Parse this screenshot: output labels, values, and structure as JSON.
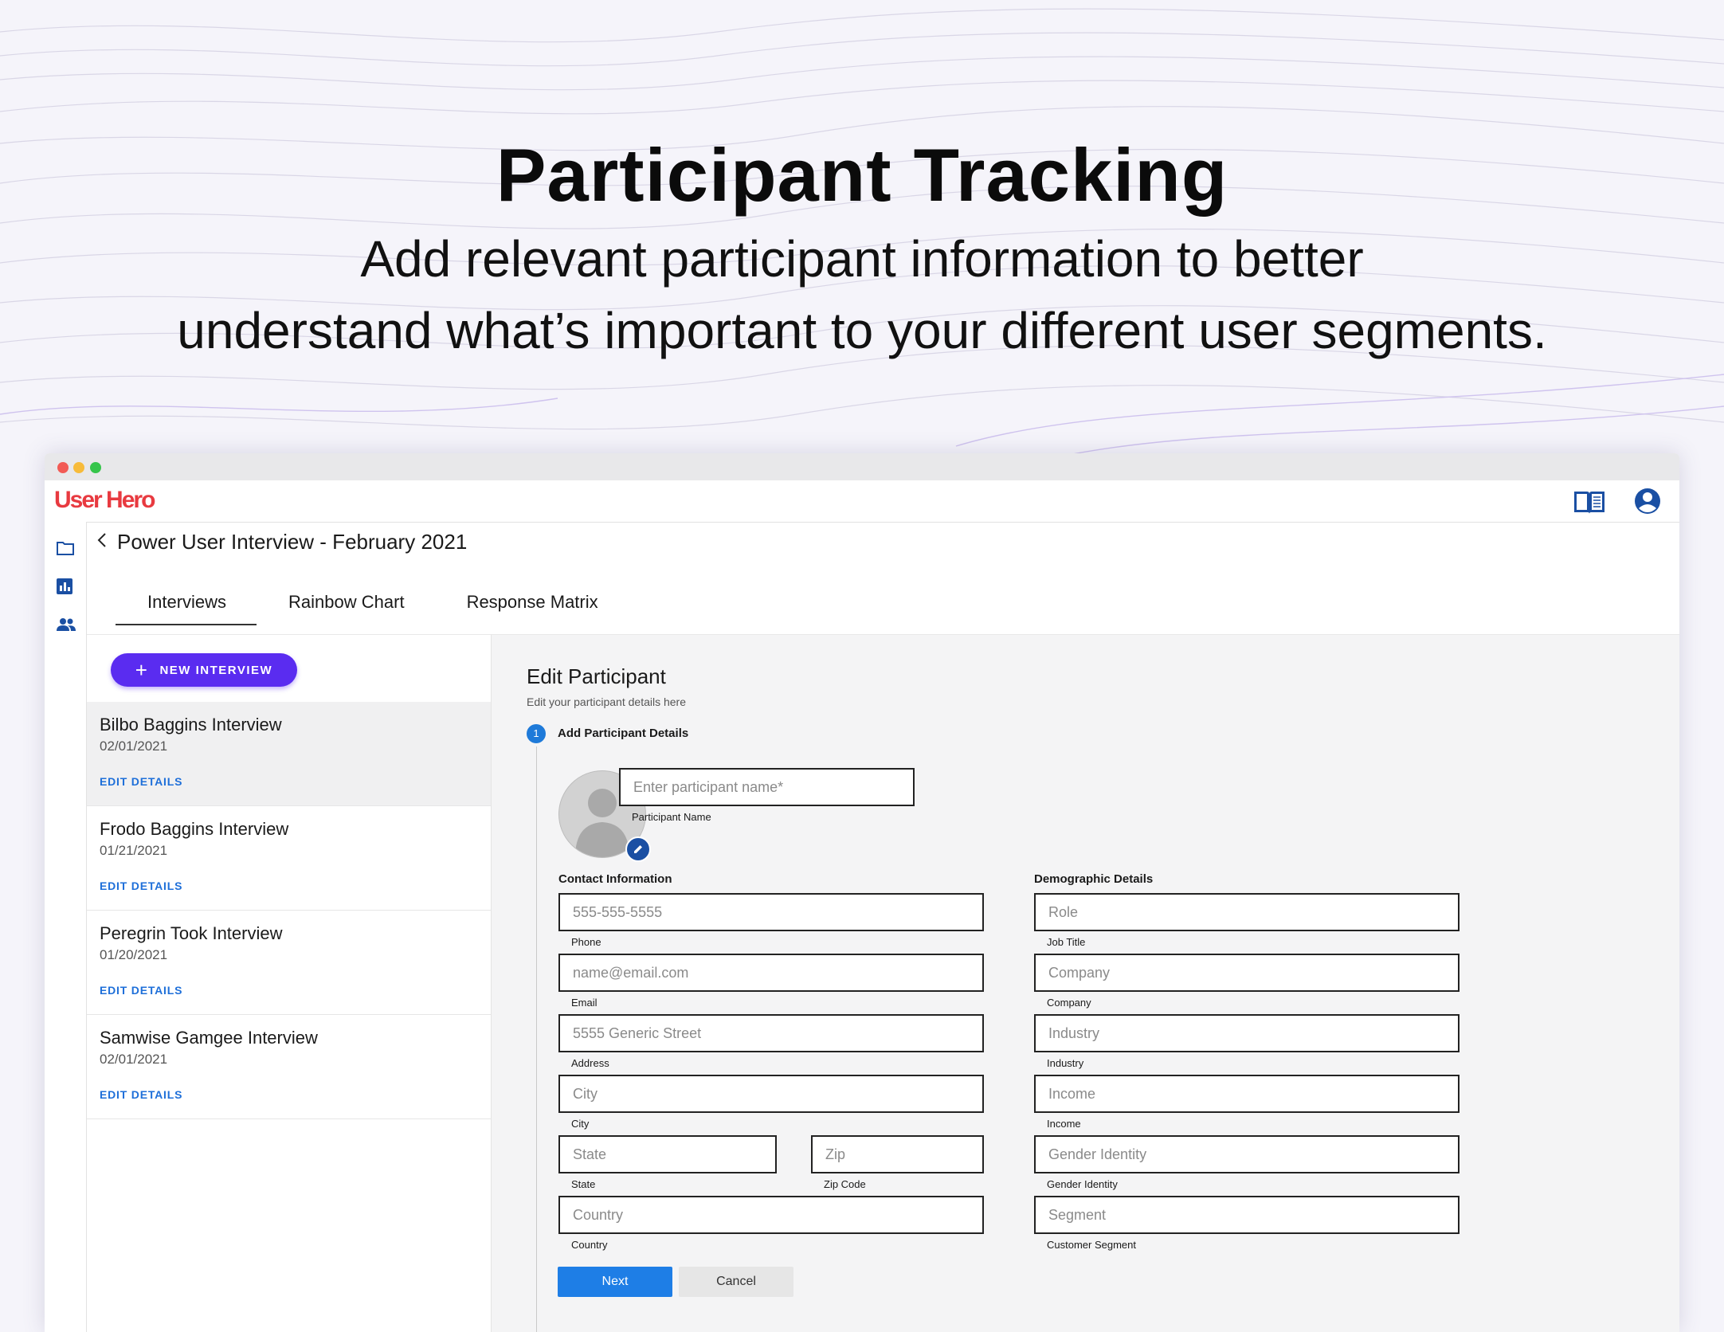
{
  "hero": {
    "title": "Participant Tracking",
    "subtitle_line1": "Add relevant participant information to better",
    "subtitle_line2": "understand what’s important to your different user segments."
  },
  "app": {
    "logo": "User Hero",
    "accent_color": "#e83a40",
    "icons": [
      "book-icon",
      "account-icon",
      "folder-icon",
      "chart-icon",
      "people-icon"
    ]
  },
  "project": {
    "title": "Power User Interview - February 2021"
  },
  "tabs": [
    {
      "label": "Interviews",
      "active": true
    },
    {
      "label": "Rainbow Chart",
      "active": false
    },
    {
      "label": "Response Matrix",
      "active": false
    }
  ],
  "new_interview_label": "NEW INTERVIEW",
  "interviews": [
    {
      "name": "Bilbo Baggins Interview",
      "date": "02/01/2021",
      "action": "EDIT DETAILS",
      "selected": true
    },
    {
      "name": "Frodo Baggins Interview",
      "date": "01/21/2021",
      "action": "EDIT DETAILS",
      "selected": false
    },
    {
      "name": "Peregrin Took Interview",
      "date": "01/20/2021",
      "action": "EDIT DETAILS",
      "selected": false
    },
    {
      "name": "Samwise Gamgee Interview",
      "date": "02/01/2021",
      "action": "EDIT DETAILS",
      "selected": false
    }
  ],
  "edit_participant": {
    "title": "Edit Participant",
    "subtitle": "Edit your participant details here",
    "step_number": "1",
    "step_label": "Add Participant Details",
    "name_placeholder": "Enter participant name*",
    "name_label": "Participant Name",
    "contact_title": "Contact Information",
    "demographic_title": "Demographic Details",
    "contact": {
      "phone": {
        "placeholder": "555-555-5555",
        "label": "Phone"
      },
      "email": {
        "placeholder": "name@email.com",
        "label": "Email"
      },
      "address": {
        "placeholder": "5555 Generic Street",
        "label": "Address"
      },
      "city": {
        "placeholder": "City",
        "label": "City"
      },
      "state": {
        "placeholder": "State",
        "label": "State"
      },
      "zip": {
        "placeholder": "Zip",
        "label": "Zip Code"
      },
      "country": {
        "placeholder": "Country",
        "label": "Country"
      }
    },
    "demographic": {
      "role": {
        "placeholder": "Role",
        "label": "Job Title"
      },
      "company": {
        "placeholder": "Company",
        "label": "Company"
      },
      "industry": {
        "placeholder": "Industry",
        "label": "Industry"
      },
      "income": {
        "placeholder": "Income",
        "label": "Income"
      },
      "gender": {
        "placeholder": "Gender Identity",
        "label": "Gender Identity"
      },
      "segment": {
        "placeholder": "Segment",
        "label": "Customer Segment"
      }
    },
    "next_label": "Next",
    "cancel_label": "Cancel"
  }
}
